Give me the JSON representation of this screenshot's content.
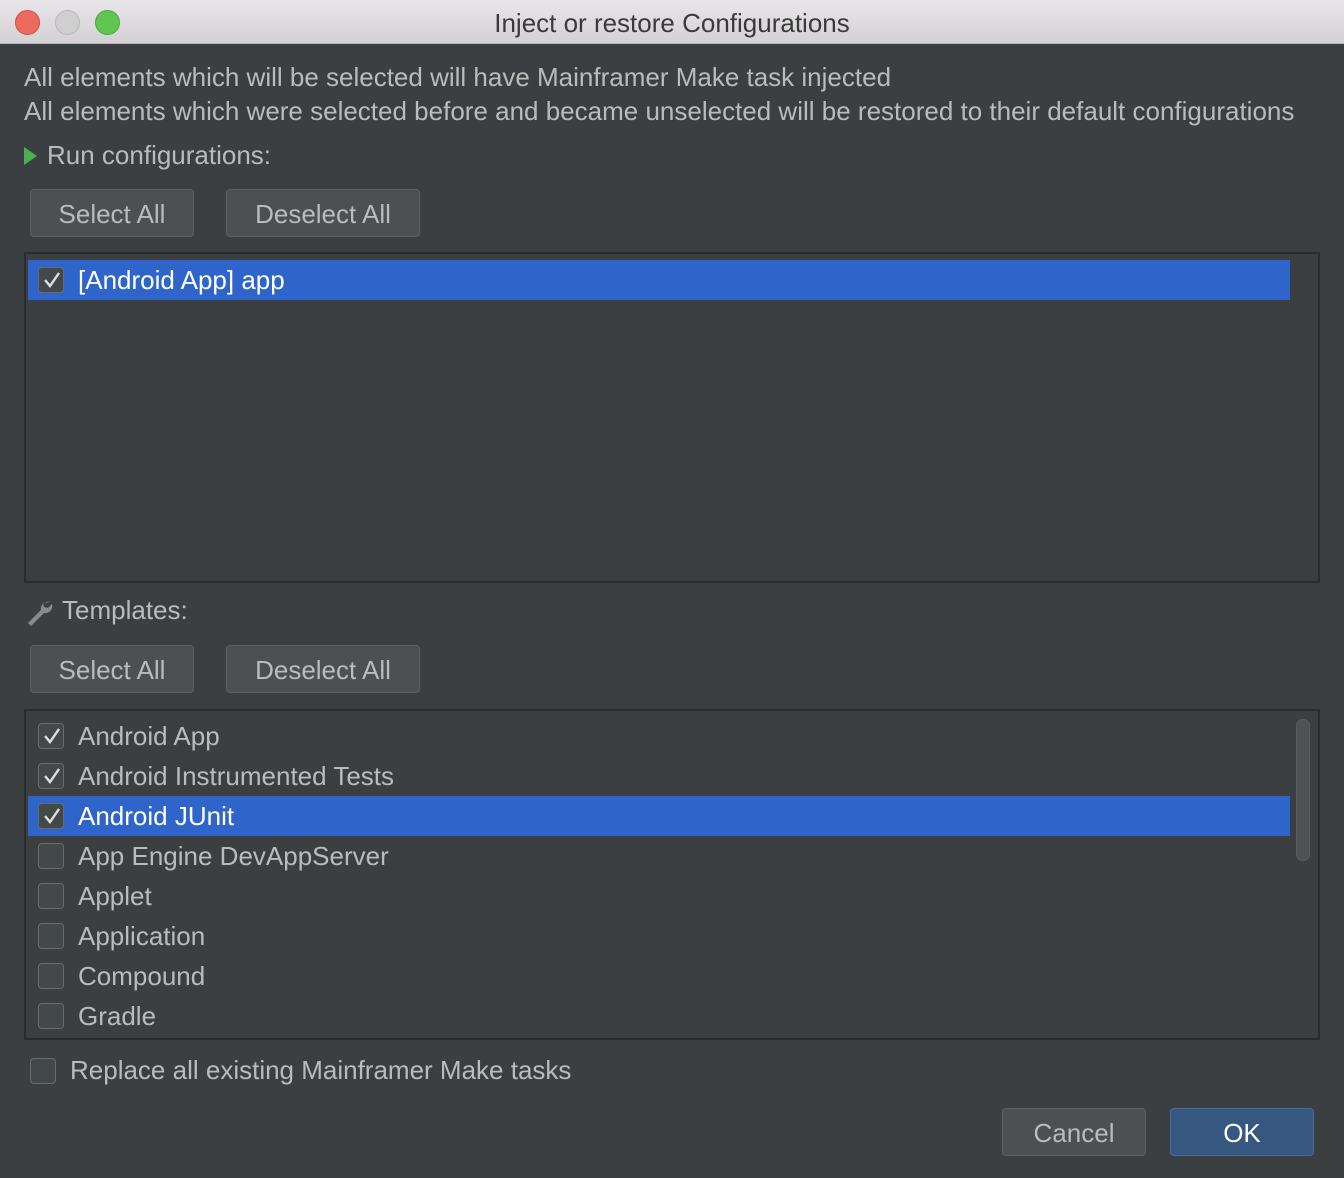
{
  "window": {
    "title": "Inject or restore Configurations"
  },
  "description": {
    "line1": "All elements which will be selected will have Mainframer Make task injected",
    "line2": "All elements which were selected before and became unselected will be restored to their default configurations"
  },
  "run_configurations": {
    "label": "Run configurations:",
    "select_all": "Select All",
    "deselect_all": "Deselect All",
    "items": [
      {
        "label": "[Android App] app",
        "checked": true,
        "selected": true
      }
    ]
  },
  "templates": {
    "label": "Templates:",
    "select_all": "Select All",
    "deselect_all": "Deselect All",
    "items": [
      {
        "label": "Android App",
        "checked": true,
        "selected": false
      },
      {
        "label": "Android Instrumented Tests",
        "checked": true,
        "selected": false
      },
      {
        "label": "Android JUnit",
        "checked": true,
        "selected": true
      },
      {
        "label": "App Engine DevAppServer",
        "checked": false,
        "selected": false
      },
      {
        "label": "Applet",
        "checked": false,
        "selected": false
      },
      {
        "label": "Application",
        "checked": false,
        "selected": false
      },
      {
        "label": "Compound",
        "checked": false,
        "selected": false
      },
      {
        "label": "Gradle",
        "checked": false,
        "selected": false
      }
    ]
  },
  "replace_option": {
    "label": "Replace all existing Mainframer Make tasks",
    "checked": false
  },
  "footer": {
    "cancel": "Cancel",
    "ok": "OK"
  },
  "colors": {
    "selection": "#2f65ca",
    "accent_green": "#4caf50",
    "ok_button": "#365880"
  }
}
